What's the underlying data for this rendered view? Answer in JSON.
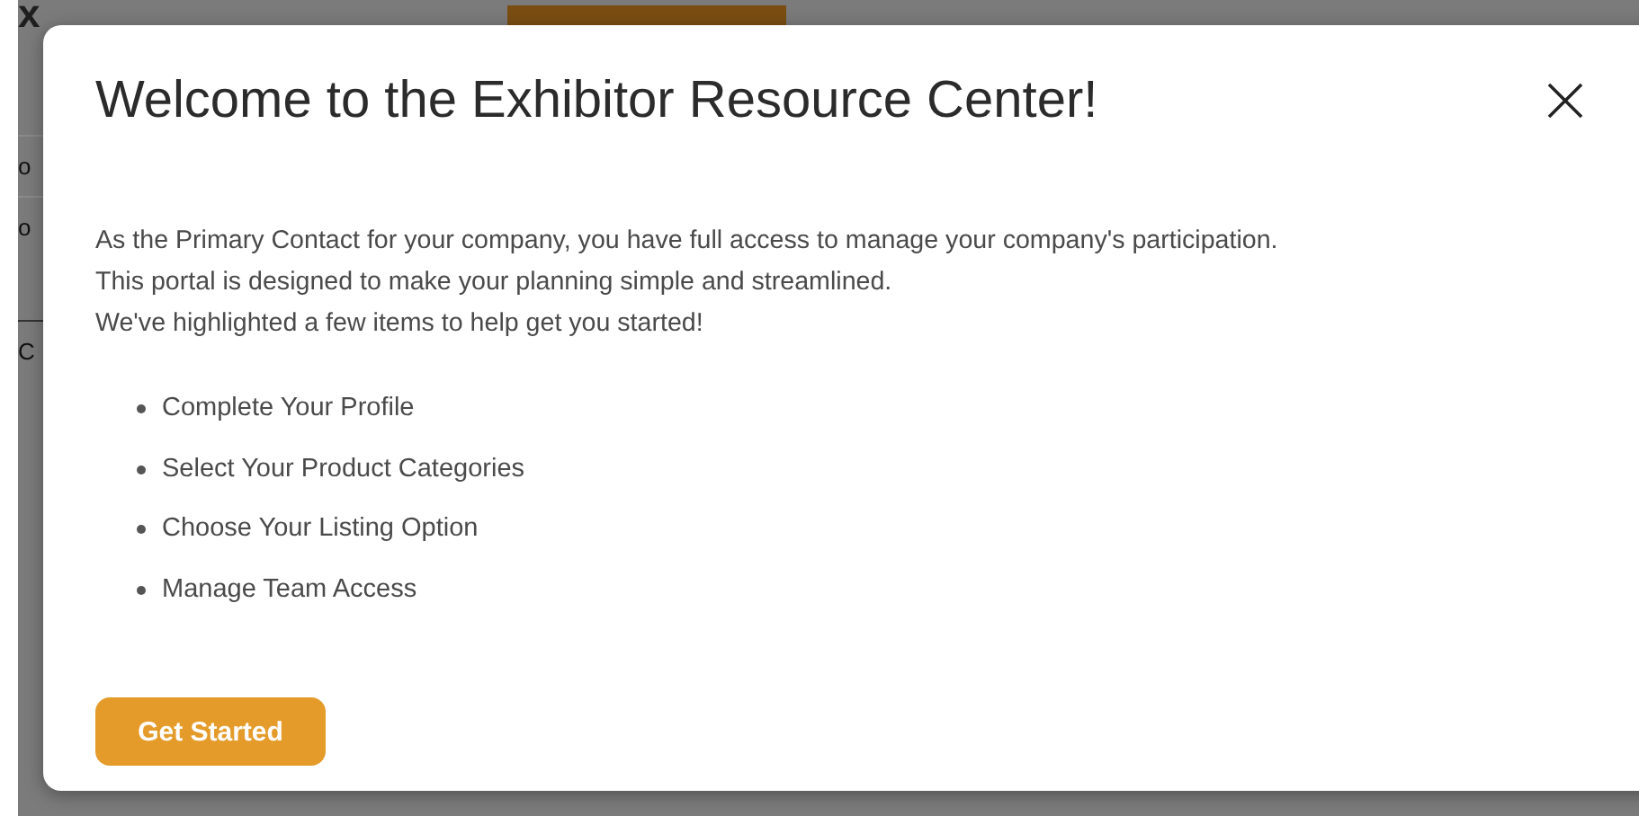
{
  "background_page": {
    "heading": "x",
    "rows": [
      "o",
      "o",
      "C"
    ]
  },
  "dialog": {
    "title": "Welcome to the Exhibitor Resource Center!",
    "paragraphs": [
      "As the Primary Contact for your company, you have full access to manage your company's participation.",
      "This portal is designed to make your planning simple and streamlined.",
      "We've highlighted a few items to help get you started!"
    ],
    "items": [
      "Complete Your Profile",
      "Select Your Product Categories",
      "Choose Your Listing Option",
      "Manage Team Access"
    ],
    "button": "Get Started"
  }
}
